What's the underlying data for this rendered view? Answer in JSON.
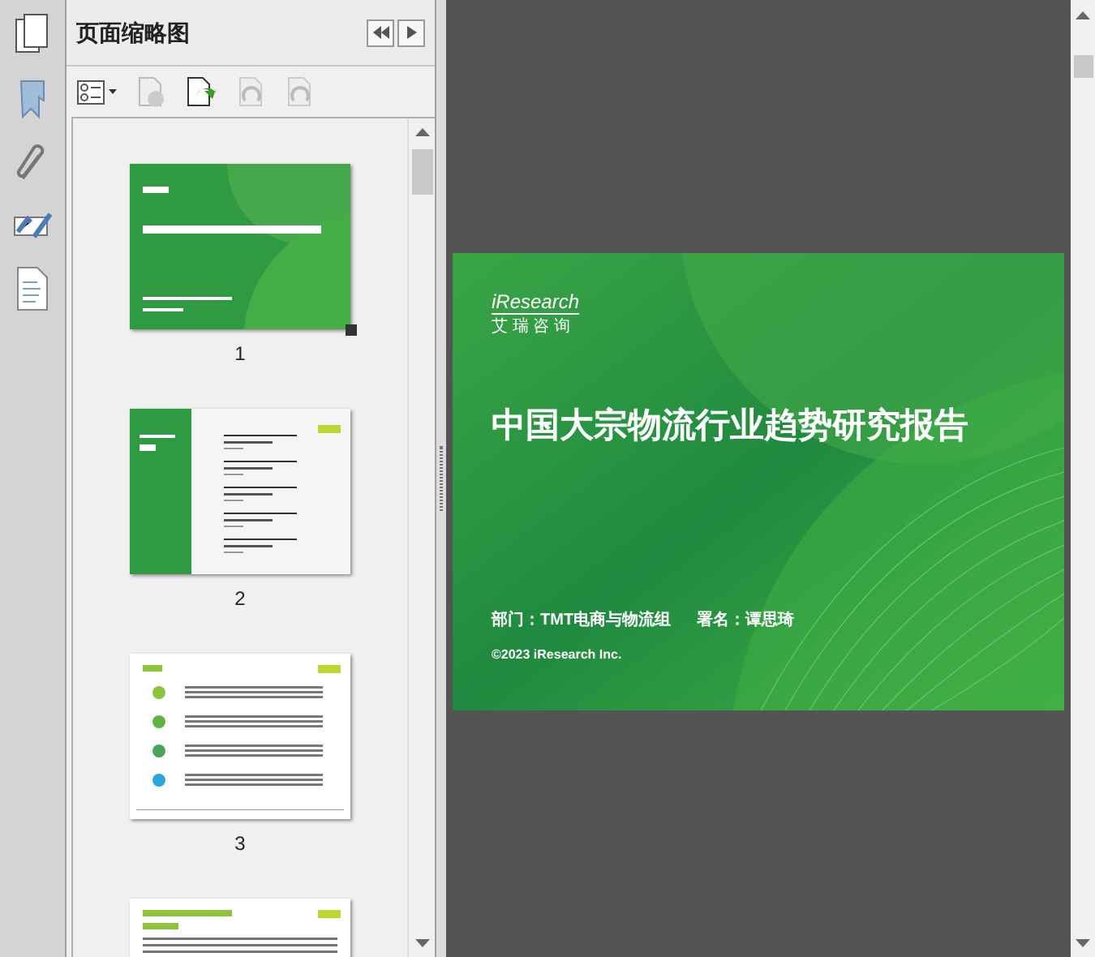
{
  "panel": {
    "title": "页面缩略图"
  },
  "pages": [
    {
      "kind": "cover",
      "label": "1",
      "selected": true
    },
    {
      "kind": "contents",
      "label": "2",
      "selected": false
    },
    {
      "kind": "summary",
      "label": "3",
      "selected": false
    },
    {
      "kind": "section"
    }
  ],
  "slide": {
    "logo": "iResearch",
    "logo_subtitle": "艾 瑞 咨 询",
    "title": "中国大宗物流行业趋势研究报告",
    "department": "部门：TMT电商与物流组",
    "author": "署名：谭思琦",
    "copyright": "©2023 iResearch Inc."
  }
}
